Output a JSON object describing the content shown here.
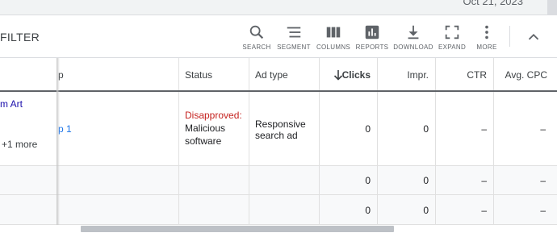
{
  "topbar": {
    "date_partial": "Oct 21, 2023"
  },
  "toolbar": {
    "filter_label": "FILTER",
    "tools": [
      {
        "label": "SEARCH",
        "icon": "search-icon"
      },
      {
        "label": "SEGMENT",
        "icon": "segment-icon"
      },
      {
        "label": "COLUMNS",
        "icon": "columns-icon"
      },
      {
        "label": "REPORTS",
        "icon": "reports-icon"
      },
      {
        "label": "DOWNLOAD",
        "icon": "download-icon"
      },
      {
        "label": "EXPAND",
        "icon": "expand-icon"
      },
      {
        "label": "MORE",
        "icon": "more-vert-icon"
      }
    ],
    "collapse_icon": "chevron-up-icon"
  },
  "table": {
    "headers": {
      "adgroup_partial": "p",
      "status": "Status",
      "ad_type": "Ad type",
      "clicks": "Clicks",
      "impr": "Impr.",
      "ctr": "CTR",
      "avg_cpc": "Avg. CPC"
    },
    "sort": {
      "column": "Clicks",
      "direction": "down",
      "icon": "arrow-down-icon"
    },
    "rows": [
      {
        "campaign_partial": "m Art",
        "more": "+1 more",
        "adgroup_partial": "p 1",
        "status_label": "Disapproved:",
        "status_reason_line1": "Malicious",
        "status_reason_line2": "software",
        "ad_type_line1": "Responsive",
        "ad_type_line2": "search ad",
        "clicks": "0",
        "impr": "0",
        "ctr": "–",
        "avg_cpc": "–"
      },
      {
        "clicks": "0",
        "impr": "0",
        "ctr": "–",
        "avg_cpc": "–"
      },
      {
        "clicks": "0",
        "impr": "0",
        "ctr": "–",
        "avg_cpc": "–"
      }
    ]
  },
  "colors": {
    "disapproved": "#c5221f",
    "link": "#1a73e8",
    "header_rule": "#5f6368"
  }
}
